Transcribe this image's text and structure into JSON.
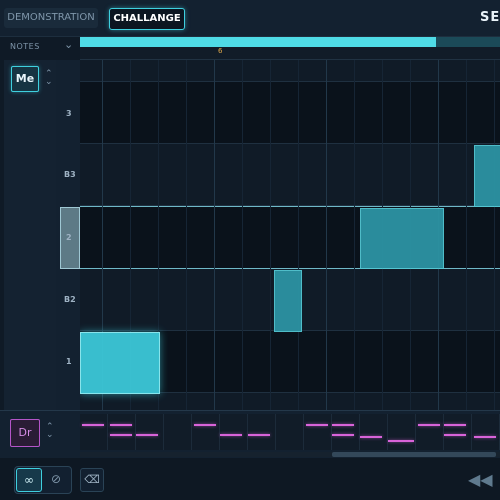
{
  "header": {
    "tabs": [
      {
        "label": "DEMONSTRATION",
        "active": false
      },
      {
        "label": "CHALLANGE",
        "active": true
      }
    ],
    "session_label": "SES"
  },
  "notes_panel": {
    "label": "NOTES",
    "ruler_marker": "6",
    "overview_progress": 0.85
  },
  "instrument": {
    "melody_label": "Me",
    "drums_label": "Dr"
  },
  "piano_rows": [
    {
      "label": "3"
    },
    {
      "label": "B3"
    },
    {
      "label": "2",
      "selected": true
    },
    {
      "label": "B2"
    },
    {
      "label": "1"
    }
  ],
  "icons": {
    "notes_collapse": "chevron-down-icon",
    "melody_toggle": "chevron-updown-icon",
    "drums_toggle": "chevron-updown-icon",
    "loop": "loop-icon",
    "no_loop": "no-loop-icon",
    "erase": "eraser-icon",
    "rewind": "rewind-icon"
  },
  "colors": {
    "accent": "#3fd0df",
    "drums_accent": "#d863d8",
    "ruler_marker": "#e0a84a"
  }
}
